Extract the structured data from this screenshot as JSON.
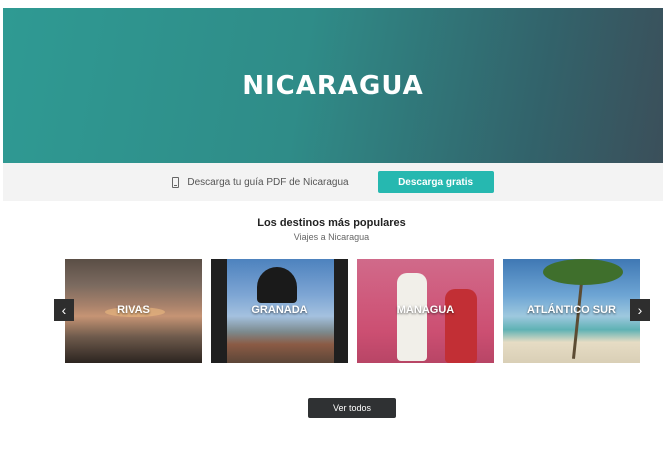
{
  "hero": {
    "title": "NICARAGUA"
  },
  "download": {
    "icon": "phone-icon",
    "text": "Descarga tu guía PDF de Nicaragua",
    "button_label": "Descarga gratis",
    "button_color": "#26b8b0"
  },
  "popular": {
    "title": "Los destinos más populares",
    "subtitle": "Viajes a Nicaragua",
    "destinations": [
      {
        "label": "RIVAS"
      },
      {
        "label": "GRANADA"
      },
      {
        "label": "MANAGUA"
      },
      {
        "label": "ATLÁNTICO SUR"
      }
    ],
    "prev_icon": "‹",
    "next_icon": "›",
    "view_all_label": "Ver todos"
  }
}
